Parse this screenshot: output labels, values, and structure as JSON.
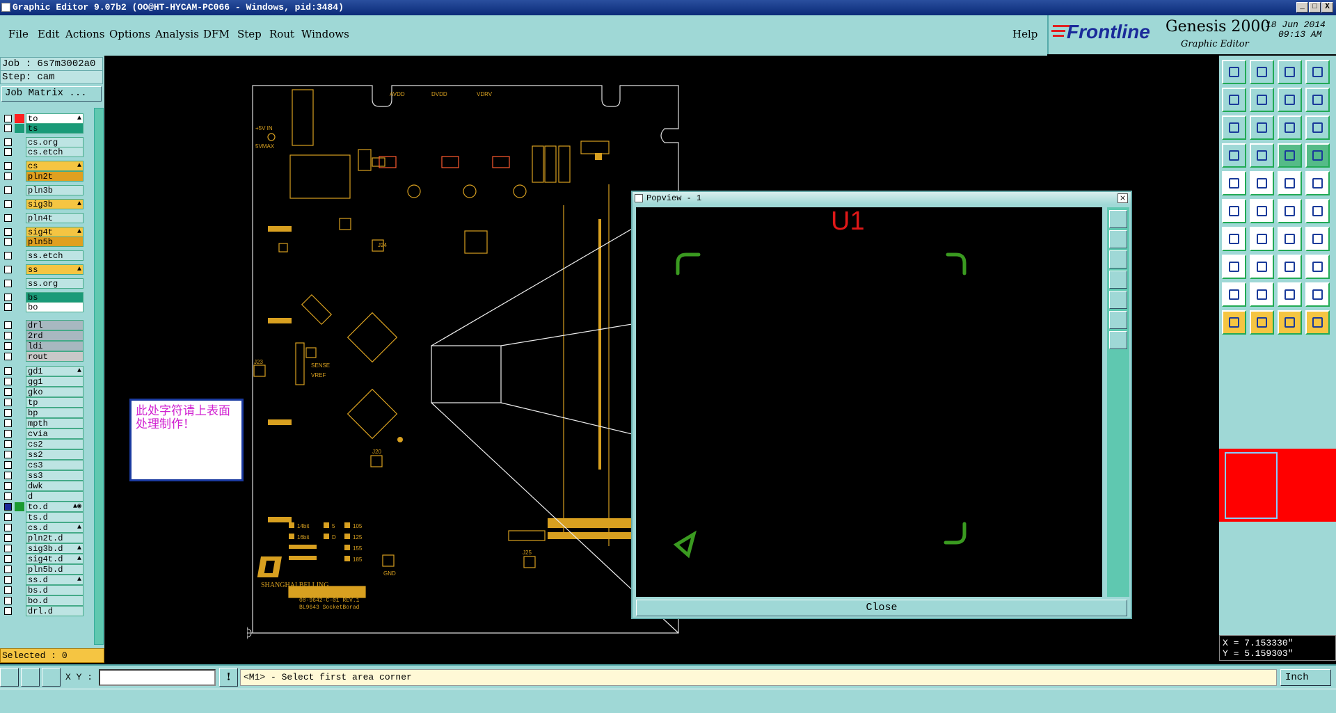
{
  "window": {
    "title": "Graphic Editor 9.07b2 (OO@HT-HYCAM-PC066 - Windows, pid:3484)",
    "min_label": "_",
    "max_label": "□",
    "close_label": "X"
  },
  "menu": [
    {
      "label": "File"
    },
    {
      "label": "Edit"
    },
    {
      "label": "Actions"
    },
    {
      "label": "Options"
    },
    {
      "label": "Analysis"
    },
    {
      "label": "DFM"
    },
    {
      "label": "Step"
    },
    {
      "label": "Rout"
    },
    {
      "label": "Windows"
    }
  ],
  "help_label": "Help",
  "brand": {
    "company": "Frontline",
    "product": "Genesis 2000",
    "subtitle": "Graphic Editor",
    "date": "18 Jun 2014",
    "time": "09:13 AM"
  },
  "left": {
    "job": "Job : 6s7m3002a0",
    "step": "Step: cam",
    "job_matrix": "Job Matrix ...",
    "selected": "Selected : 0"
  },
  "layers": [
    {
      "name": "to",
      "color": "#ffffff",
      "swatch": "#ff2020",
      "mark": "▲"
    },
    {
      "name": "ts",
      "color": "#1a9a78",
      "swatch": "#1a9a78",
      "mark": ""
    },
    {
      "name": "cs.org",
      "color": "#bde4e3",
      "swatch": "",
      "mark": ""
    },
    {
      "name": "cs.etch",
      "color": "#bde4e3",
      "swatch": "",
      "mark": ""
    },
    {
      "name": "cs",
      "color": "#f5c542",
      "swatch": "",
      "mark": "▲"
    },
    {
      "name": "pln2t",
      "color": "#e0a020",
      "swatch": "",
      "mark": ""
    },
    {
      "name": "pln3b",
      "color": "#bde4e3",
      "swatch": "",
      "mark": ""
    },
    {
      "name": "sig3b",
      "color": "#f5c542",
      "swatch": "",
      "mark": "▲"
    },
    {
      "name": "pln4t",
      "color": "#bde4e3",
      "swatch": "",
      "mark": ""
    },
    {
      "name": "sig4t",
      "color": "#f5c542",
      "swatch": "",
      "mark": "▲"
    },
    {
      "name": "pln5b",
      "color": "#e0a020",
      "swatch": "",
      "mark": ""
    },
    {
      "name": "ss.etch",
      "color": "#bde4e3",
      "swatch": "",
      "mark": ""
    },
    {
      "name": "ss",
      "color": "#f5c542",
      "swatch": "",
      "mark": "▲"
    },
    {
      "name": "ss.org",
      "color": "#bde4e3",
      "swatch": "",
      "mark": ""
    },
    {
      "name": "bs",
      "color": "#1a9a78",
      "swatch": "",
      "mark": ""
    },
    {
      "name": "bo",
      "color": "#ffffff",
      "swatch": "",
      "mark": ""
    },
    {
      "name": "drl",
      "color": "#a8b8c0",
      "swatch": "",
      "mark": ""
    },
    {
      "name": "2rd",
      "color": "#a8b8c0",
      "swatch": "",
      "mark": ""
    },
    {
      "name": "ldi",
      "color": "#a8b8c0",
      "swatch": "",
      "mark": ""
    },
    {
      "name": "rout",
      "color": "#c8c8c8",
      "swatch": "",
      "mark": ""
    },
    {
      "name": "gd1",
      "color": "#bde4e3",
      "swatch": "",
      "mark": "▲"
    },
    {
      "name": "gg1",
      "color": "#bde4e3",
      "swatch": "",
      "mark": ""
    },
    {
      "name": "gko",
      "color": "#bde4e3",
      "swatch": "",
      "mark": ""
    },
    {
      "name": "tp",
      "color": "#bde4e3",
      "swatch": "",
      "mark": ""
    },
    {
      "name": "bp",
      "color": "#bde4e3",
      "swatch": "",
      "mark": ""
    },
    {
      "name": "mpth",
      "color": "#bde4e3",
      "swatch": "",
      "mark": ""
    },
    {
      "name": "cvia",
      "color": "#bde4e3",
      "swatch": "",
      "mark": ""
    },
    {
      "name": "cs2",
      "color": "#bde4e3",
      "swatch": "",
      "mark": ""
    },
    {
      "name": "ss2",
      "color": "#bde4e3",
      "swatch": "",
      "mark": ""
    },
    {
      "name": "cs3",
      "color": "#bde4e3",
      "swatch": "",
      "mark": ""
    },
    {
      "name": "ss3",
      "color": "#bde4e3",
      "swatch": "",
      "mark": ""
    },
    {
      "name": "dwk",
      "color": "#bde4e3",
      "swatch": "",
      "mark": ""
    },
    {
      "name": "d",
      "color": "#bde4e3",
      "swatch": "",
      "mark": ""
    },
    {
      "name": "to.d",
      "color": "#bde4e3",
      "swatch": "#1a9a30",
      "mark": "▲◉"
    },
    {
      "name": "ts.d",
      "color": "#bde4e3",
      "swatch": "",
      "mark": ""
    },
    {
      "name": "cs.d",
      "color": "#bde4e3",
      "swatch": "",
      "mark": "▲"
    },
    {
      "name": "pln2t.d",
      "color": "#bde4e3",
      "swatch": "",
      "mark": ""
    },
    {
      "name": "sig3b.d",
      "color": "#bde4e3",
      "swatch": "",
      "mark": "▲"
    },
    {
      "name": "sig4t.d",
      "color": "#bde4e3",
      "swatch": "",
      "mark": "▲"
    },
    {
      "name": "pln5b.d",
      "color": "#bde4e3",
      "swatch": "",
      "mark": ""
    },
    {
      "name": "ss.d",
      "color": "#bde4e3",
      "swatch": "",
      "mark": "▲"
    },
    {
      "name": "bs.d",
      "color": "#bde4e3",
      "swatch": "",
      "mark": ""
    },
    {
      "name": "bo.d",
      "color": "#bde4e3",
      "swatch": "",
      "mark": ""
    },
    {
      "name": "drl.d",
      "color": "#bde4e3",
      "swatch": "",
      "mark": ""
    }
  ],
  "board": {
    "note": "此处字符请上表面处理制作！",
    "silk_company": "SHANGHAI BELLING",
    "silk_part": "08-9642-C-01 REV.1",
    "silk_name": "BL9643 SocketBorad",
    "silk_5v": "+5V IN",
    "silk_5vmax": "5VMAX",
    "silk_sense": "SENSE",
    "silk_vref": "VREF",
    "silk_legend": [
      "14bit",
      "16bit",
      "5",
      "D",
      "105",
      "125",
      "155",
      "185"
    ],
    "silk_ref_j22": "J22",
    "silk_gnd": "GND",
    "silk_j23": "J23",
    "silk_j25": "J25",
    "silk_j20": "J20",
    "silk_j24": "J24",
    "silk_avdd": "AVDD",
    "silk_dvdd": "DVDD",
    "silk_vdrv": "VDRV"
  },
  "popview": {
    "title": "Popview - 1",
    "label": "U1",
    "close": "Close"
  },
  "coords": {
    "x": "X = 7.153330\"",
    "y": "Y = 5.159303\""
  },
  "bottom": {
    "xy_label": "X Y :",
    "xy_value": "",
    "message": "<M1> - Select first area corner",
    "unit": "Inch"
  },
  "colors": {
    "panel": "#9fd8d6",
    "silk": "#d8a020",
    "pop_green": "#3a9a20",
    "pop_red": "#e01818"
  }
}
